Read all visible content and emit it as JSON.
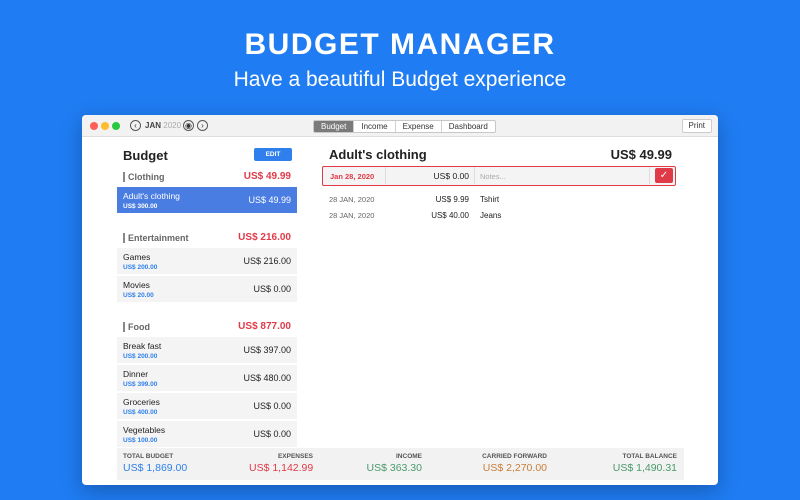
{
  "hero": {
    "title": "BUDGET MANAGER",
    "subtitle": "Have a beautiful Budget experience"
  },
  "titlebar": {
    "month": "JAN",
    "year": "2020",
    "tabs": [
      {
        "label": "Budget",
        "active": true
      },
      {
        "label": "Income",
        "active": false
      },
      {
        "label": "Expense",
        "active": false
      },
      {
        "label": "Dashboard",
        "active": false
      }
    ],
    "print_label": "Print"
  },
  "left": {
    "title": "Budget",
    "edit_label": "EDIT",
    "categories": [
      {
        "name": "Clothing",
        "amount": "US$ 49.99",
        "items": [
          {
            "name": "Adult's clothing",
            "budget": "US$ 300.00",
            "value": "US$ 49.99",
            "selected": true
          }
        ]
      },
      {
        "name": "Entertainment",
        "amount": "US$ 216.00",
        "items": [
          {
            "name": "Games",
            "budget": "US$ 200.00",
            "value": "US$ 216.00"
          },
          {
            "name": "Movies",
            "budget": "US$ 20.00",
            "value": "US$ 0.00"
          }
        ]
      },
      {
        "name": "Food",
        "amount": "US$ 877.00",
        "items": [
          {
            "name": "Break fast",
            "budget": "US$ 200.00",
            "value": "US$ 397.00"
          },
          {
            "name": "Dinner",
            "budget": "US$ 399.00",
            "value": "US$ 480.00"
          },
          {
            "name": "Groceries",
            "budget": "US$ 400.00",
            "value": "US$ 0.00"
          },
          {
            "name": "Vegetables",
            "budget": "US$ 100.00",
            "value": "US$ 0.00"
          }
        ]
      }
    ]
  },
  "right": {
    "title": "Adult's clothing",
    "total": "US$ 49.99",
    "entry": {
      "date": "Jan 28, 2020",
      "amount": "US$ 0.00",
      "notes_placeholder": "Notes...",
      "check_icon": "✓"
    },
    "transactions": [
      {
        "date": "28 JAN, 2020",
        "amount": "US$ 9.99",
        "note": "Tshirt"
      },
      {
        "date": "28 JAN, 2020",
        "amount": "US$ 40.00",
        "note": "Jeans"
      }
    ]
  },
  "footer": [
    {
      "label": "TOTAL BUDGET",
      "value": "US$ 1,869.00",
      "color": "#2f80ed"
    },
    {
      "label": "EXPENSES",
      "value": "US$ 1,142.99",
      "color": "#e03a48"
    },
    {
      "label": "INCOME",
      "value": "US$ 363.30",
      "color": "#4a9a6a"
    },
    {
      "label": "CARRIED FORWARD",
      "value": "US$ 2,270.00",
      "color": "#c87f3a"
    },
    {
      "label": "TOTAL BALANCE",
      "value": "US$ 1,490.31",
      "color": "#4a9a6a"
    }
  ],
  "colors": {
    "background": "#1f7cf2",
    "accent": "#2f80ed",
    "negative": "#e03a48",
    "positive": "#4a9a6a"
  }
}
